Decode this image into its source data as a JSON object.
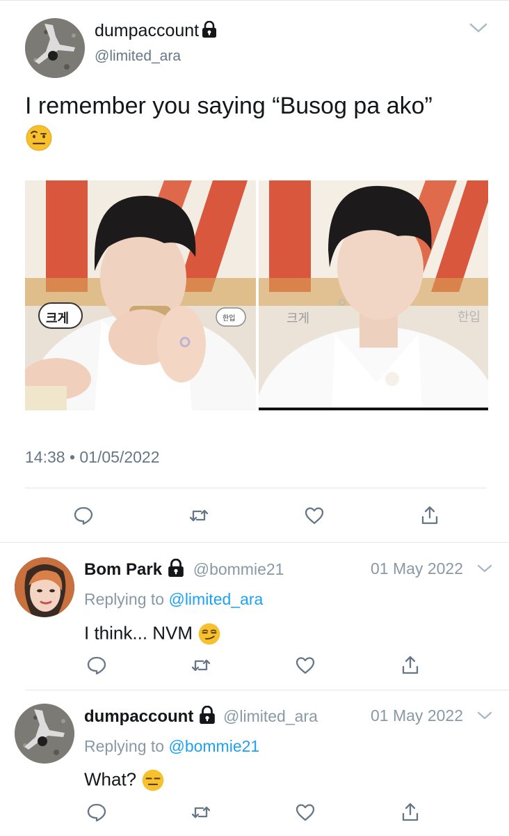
{
  "tweet": {
    "display_name": "dumpaccount",
    "handle": "@limited_ara",
    "text": "I remember you saying “Busog pa ako”",
    "emoji": "raised-eyebrow-emoji",
    "timestamp": "14:38 • 01/05/2022",
    "images": [
      {
        "caption_left": "크게",
        "caption_right": "한입"
      },
      {
        "caption_left": "크게",
        "caption_right": "한입"
      }
    ],
    "actions": [
      "reply-icon",
      "retweet-icon",
      "like-icon",
      "share-icon"
    ]
  },
  "replies": [
    {
      "display_name": "Bom Park",
      "handle": "@bommie21",
      "date": "01 May 2022",
      "replying_label": "Replying to",
      "replying_to": "@limited_ara",
      "text": "I think... NVM",
      "emoji": "smirking-face-emoji"
    },
    {
      "display_name": "dumpaccount",
      "handle": "@limited_ara",
      "date": "01 May 2022",
      "replying_label": "Replying to",
      "replying_to": "@bommie21",
      "text": "What?",
      "emoji": "expressionless-face-emoji"
    }
  ],
  "colors": {
    "link": "#1da1f2",
    "secondary": "#657786",
    "divider": "#e1e8ed"
  }
}
